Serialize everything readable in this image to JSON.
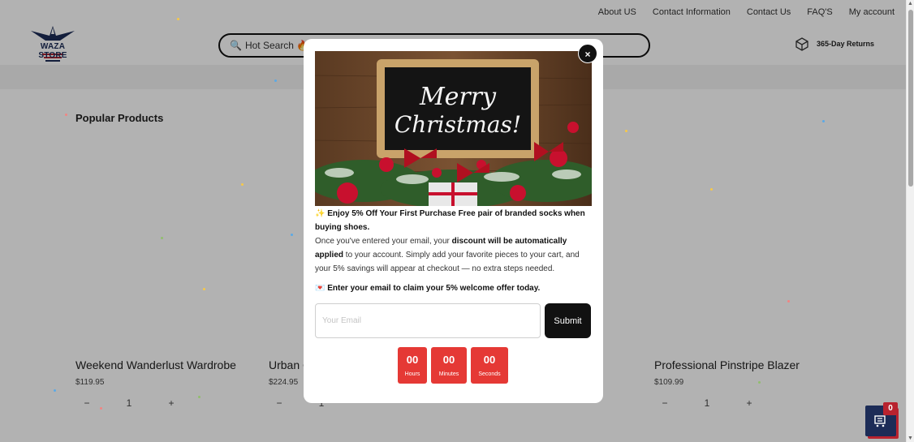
{
  "topnav": [
    "About US",
    "Contact Information",
    "Contact Us",
    "FAQ'S",
    "My account"
  ],
  "logo": {
    "text": "WAZA STORE"
  },
  "search": {
    "placeholder": "Hot Search 🔥 ..."
  },
  "returns": {
    "label": "365-Day Returns"
  },
  "section_title": "Popular Products",
  "products": [
    {
      "name": "Weekend Wanderlust Wardrobe",
      "price": "$119.95",
      "qty": "1"
    },
    {
      "name": "Urban C",
      "price": "$224.95",
      "qty": "1"
    },
    {
      "name": "Professional Pinstripe Blazer",
      "price": "$109.99",
      "qty": "1"
    }
  ],
  "qty_controls": {
    "minus": "−",
    "plus": "+"
  },
  "cart": {
    "count": "0"
  },
  "modal": {
    "close": "×",
    "hero_text": [
      "Merry",
      "Christmas!"
    ],
    "headline": "✨ Enjoy 5% Off Your First Purchase Free pair of branded socks when buying shoes.",
    "body_1": "Once you've entered your email, your ",
    "body_bold": "discount will be automatically applied",
    "body_2": " to your account. Simply add your favorite pieces to your cart, and your 5% savings will appear at checkout — no extra steps needed.",
    "claim": "💌 Enter your email to claim your 5% welcome offer today.",
    "email_placeholder": "Your Email",
    "submit": "Submit",
    "timer": [
      {
        "value": "00",
        "unit": "Hours"
      },
      {
        "value": "00",
        "unit": "Minutes"
      },
      {
        "value": "00",
        "unit": "Seconds"
      }
    ]
  },
  "colors": {
    "accent_red": "#e53935",
    "navy": "#1c2c57",
    "brand_red": "#b8232f"
  }
}
